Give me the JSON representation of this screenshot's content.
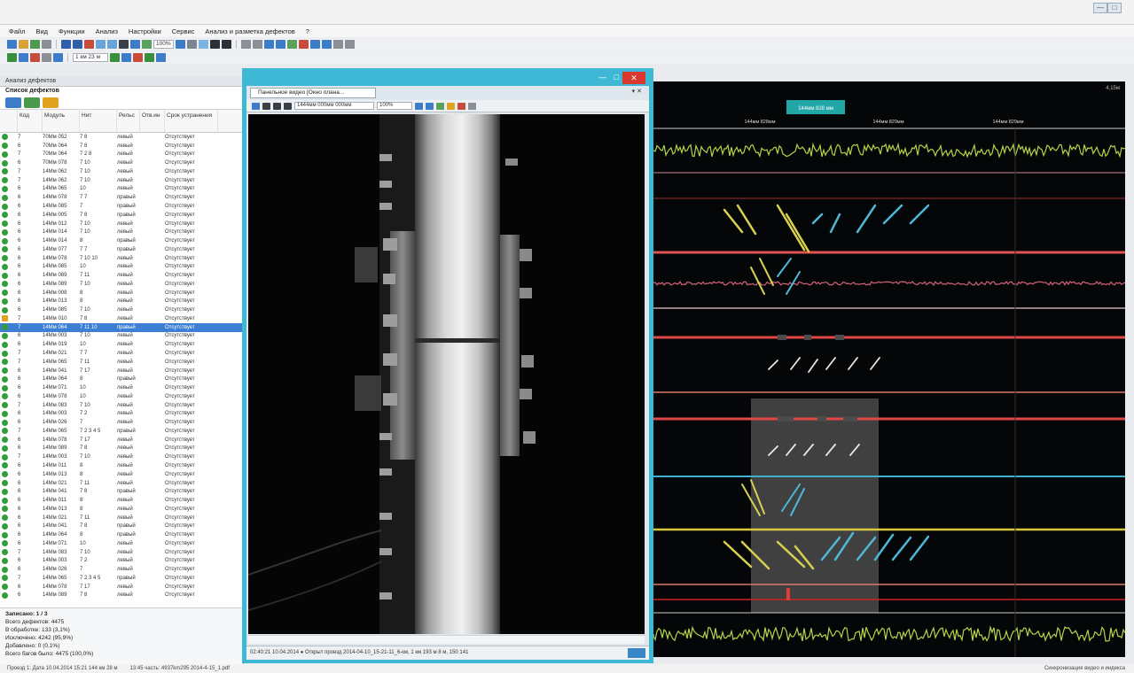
{
  "window": {
    "menu": [
      "Файл",
      "Вид",
      "Функции",
      "Анализ",
      "Настройки",
      "Сервис",
      "Анализ и разметка дефектов",
      "?"
    ],
    "zoom": "100%"
  },
  "left_panel": {
    "tab_label": "Анализ дефектов",
    "section_title": "Список дефектов",
    "columns": [
      "Код",
      "Модуль",
      "Нит",
      "Рельс",
      "Отв.ин",
      "Срок устранения"
    ],
    "rows": [
      {
        "c0": "7",
        "c1": "70Мм 052",
        "c2": "7 8",
        "c3": "левый",
        "c4": "",
        "c5": "Отсутствует"
      },
      {
        "c0": "6",
        "c1": "70Мм 064",
        "c2": "7 8",
        "c3": "левый",
        "c4": "",
        "c5": "Отсутствует"
      },
      {
        "c0": "7",
        "c1": "70Мм 064",
        "c2": "7 2 8",
        "c3": "левый",
        "c4": "",
        "c5": "Отсутствует"
      },
      {
        "c0": "6",
        "c1": "70Мм 078",
        "c2": "7 10",
        "c3": "левый",
        "c4": "",
        "c5": "Отсутствует"
      },
      {
        "c0": "7",
        "c1": "14Мм 062",
        "c2": "7 10",
        "c3": "левый",
        "c4": "",
        "c5": "Отсутствует"
      },
      {
        "c0": "7",
        "c1": "14Мм 062",
        "c2": "7 10",
        "c3": "левый",
        "c4": "",
        "c5": "Отсутствует"
      },
      {
        "c0": "6",
        "c1": "14Мм 065",
        "c2": "10",
        "c3": "левый",
        "c4": "",
        "c5": "Отсутствует"
      },
      {
        "c0": "6",
        "c1": "14Мм 078",
        "c2": "7 7",
        "c3": "правый",
        "c4": "",
        "c5": "Отсутствует"
      },
      {
        "c0": "6",
        "c1": "14Мм 085",
        "c2": "7",
        "c3": "правый",
        "c4": "",
        "c5": "Отсутствует"
      },
      {
        "c0": "6",
        "c1": "14Мм 005",
        "c2": "7 8",
        "c3": "правый",
        "c4": "",
        "c5": "Отсутствует"
      },
      {
        "c0": "6",
        "c1": "14Мм 012",
        "c2": "7 10",
        "c3": "левый",
        "c4": "",
        "c5": "Отсутствует"
      },
      {
        "c0": "6",
        "c1": "14Мм 014",
        "c2": "7 10",
        "c3": "левый",
        "c4": "",
        "c5": "Отсутствует"
      },
      {
        "c0": "6",
        "c1": "14Мм 014",
        "c2": "8",
        "c3": "правый",
        "c4": "",
        "c5": "Отсутствует"
      },
      {
        "c0": "6",
        "c1": "14Мм 077",
        "c2": "7 7",
        "c3": "правый",
        "c4": "",
        "c5": "Отсутствует"
      },
      {
        "c0": "6",
        "c1": "14Мм 078",
        "c2": "7 10 10",
        "c3": "левый",
        "c4": "",
        "c5": "Отсутствует"
      },
      {
        "c0": "6",
        "c1": "14Мм 085",
        "c2": "10",
        "c3": "левый",
        "c4": "",
        "c5": "Отсутствует"
      },
      {
        "c0": "6",
        "c1": "14Мм 089",
        "c2": "7 11",
        "c3": "левый",
        "c4": "",
        "c5": "Отсутствует"
      },
      {
        "c0": "6",
        "c1": "14Мм 089",
        "c2": "7 10",
        "c3": "левый",
        "c4": "",
        "c5": "Отсутствует"
      },
      {
        "c0": "6",
        "c1": "14Мм 008",
        "c2": "8",
        "c3": "левый",
        "c4": "",
        "c5": "Отсутствует"
      },
      {
        "c0": "6",
        "c1": "14Мм 013",
        "c2": "8",
        "c3": "левый",
        "c4": "",
        "c5": "Отсутствует"
      },
      {
        "c0": "6",
        "c1": "14Мм 085",
        "c2": "7 10",
        "c3": "левый",
        "c4": "",
        "c5": "Отсутствует"
      },
      {
        "c0": "7",
        "c1": "14Мм 010",
        "c2": "7 8",
        "c3": "левый",
        "c4": "",
        "c5": "Отсутствует",
        "warn": true
      },
      {
        "c0": "7",
        "c1": "14Мм 064",
        "c2": "7 11 10",
        "c3": "правый",
        "c4": "",
        "c5": "Отсутствует",
        "selected": true
      },
      {
        "c0": "6",
        "c1": "14Мм 003",
        "c2": "7 10",
        "c3": "левый",
        "c4": "",
        "c5": "Отсутствует"
      },
      {
        "c0": "6",
        "c1": "14Мм 019",
        "c2": "10",
        "c3": "левый",
        "c4": "",
        "c5": "Отсутствует"
      },
      {
        "c0": "7",
        "c1": "14Мм 021",
        "c2": "7 7",
        "c3": "левый",
        "c4": "",
        "c5": "Отсутствует"
      },
      {
        "c0": "7",
        "c1": "14Мм 065",
        "c2": "7 11",
        "c3": "левый",
        "c4": "",
        "c5": "Отсутствует"
      },
      {
        "c0": "6",
        "c1": "14Мм 041",
        "c2": "7 17",
        "c3": "левый",
        "c4": "",
        "c5": "Отсутствует"
      },
      {
        "c0": "6",
        "c1": "14Мм 064",
        "c2": "8",
        "c3": "правый",
        "c4": "",
        "c5": "Отсутствует"
      },
      {
        "c0": "6",
        "c1": "14Мм 071",
        "c2": "10",
        "c3": "левый",
        "c4": "",
        "c5": "Отсутствует"
      },
      {
        "c0": "6",
        "c1": "14Мм 078",
        "c2": "10",
        "c3": "левый",
        "c4": "",
        "c5": "Отсутствует"
      },
      {
        "c0": "7",
        "c1": "14Мм 083",
        "c2": "7 10",
        "c3": "левый",
        "c4": "",
        "c5": "Отсутствует"
      },
      {
        "c0": "6",
        "c1": "14Мм 003",
        "c2": "7 2",
        "c3": "левый",
        "c4": "",
        "c5": "Отсутствует"
      },
      {
        "c0": "6",
        "c1": "14Мм 026",
        "c2": "7",
        "c3": "левый",
        "c4": "",
        "c5": "Отсутствует"
      },
      {
        "c0": "7",
        "c1": "14Мм 065",
        "c2": "7 2 3 4 5",
        "c3": "правый",
        "c4": "",
        "c5": "Отсутствует"
      },
      {
        "c0": "6",
        "c1": "14Мм 078",
        "c2": "7 17",
        "c3": "левый",
        "c4": "",
        "c5": "Отсутствует"
      },
      {
        "c0": "6",
        "c1": "14Мм 089",
        "c2": "7 8",
        "c3": "левый",
        "c4": "",
        "c5": "Отсутствует"
      },
      {
        "c0": "7",
        "c1": "14Мм 003",
        "c2": "7 10",
        "c3": "левый",
        "c4": "",
        "c5": "Отсутствует"
      },
      {
        "c0": "6",
        "c1": "14Мм 011",
        "c2": "8",
        "c3": "левый",
        "c4": "",
        "c5": "Отсутствует"
      },
      {
        "c0": "6",
        "c1": "14Мм 013",
        "c2": "8",
        "c3": "левый",
        "c4": "",
        "c5": "Отсутствует"
      },
      {
        "c0": "6",
        "c1": "14Мм 021",
        "c2": "7 11",
        "c3": "левый",
        "c4": "",
        "c5": "Отсутствует"
      },
      {
        "c0": "6",
        "c1": "14Мм 041",
        "c2": "7 8",
        "c3": "правый",
        "c4": "",
        "c5": "Отсутствует"
      },
      {
        "c0": "6",
        "c1": "14Мм 011",
        "c2": "8",
        "c3": "левый",
        "c4": "",
        "c5": "Отсутствует"
      },
      {
        "c0": "6",
        "c1": "14Мм 013",
        "c2": "8",
        "c3": "левый",
        "c4": "",
        "c5": "Отсутствует"
      },
      {
        "c0": "6",
        "c1": "14Мм 021",
        "c2": "7 11",
        "c3": "левый",
        "c4": "",
        "c5": "Отсутствует"
      },
      {
        "c0": "6",
        "c1": "14Мм 041",
        "c2": "7 8",
        "c3": "правый",
        "c4": "",
        "c5": "Отсутствует"
      },
      {
        "c0": "6",
        "c1": "14Мм 064",
        "c2": "8",
        "c3": "правый",
        "c4": "",
        "c5": "Отсутствует"
      },
      {
        "c0": "6",
        "c1": "14Мм 071",
        "c2": "10",
        "c3": "левый",
        "c4": "",
        "c5": "Отсутствует"
      },
      {
        "c0": "7",
        "c1": "14Мм 083",
        "c2": "7 10",
        "c3": "левый",
        "c4": "",
        "c5": "Отсутствует"
      },
      {
        "c0": "6",
        "c1": "14Мм 003",
        "c2": "7 2",
        "c3": "левый",
        "c4": "",
        "c5": "Отсутствует"
      },
      {
        "c0": "6",
        "c1": "14Мм 026",
        "c2": "7",
        "c3": "левый",
        "c4": "",
        "c5": "Отсутствует"
      },
      {
        "c0": "7",
        "c1": "14Мм 065",
        "c2": "7 2 3 4 5",
        "c3": "правый",
        "c4": "",
        "c5": "Отсутствует"
      },
      {
        "c0": "6",
        "c1": "14Мм 078",
        "c2": "7 17",
        "c3": "левый",
        "c4": "",
        "c5": "Отсутствует"
      },
      {
        "c0": "6",
        "c1": "14Мм 089",
        "c2": "7 8",
        "c3": "левый",
        "c4": "",
        "c5": "Отсутствует"
      }
    ],
    "summary": [
      "Записано: 1 / 3",
      "Всего дефектов: 4475",
      "В обработке: 133 (3,1%)",
      "Исключено: 4242 (95,9%)",
      "Добавлено: 0 (0,1%)",
      "Всего багов было: 4475 (100,0%)"
    ]
  },
  "video": {
    "tab_title": "Панельное видео [Окно плана...",
    "tab_ctrl": "▾ ✕",
    "window_min": "—",
    "window_max": "□",
    "window_close": "✕",
    "toolbar_field": "1 км 23 м",
    "toolbar_field2": "1444мм 000мм 000мм",
    "toolbar_zoom": "100%",
    "status": "02:40:21 10.04.2014 ● Открыт проезд 2014-04-10_15-21-11_6-км, 1 км 193 м 8 м, 150 141"
  },
  "signal": {
    "top_right": "4,15м",
    "markers": [
      "144мм 828мм",
      "144мм 829мм",
      "144мм 829мм"
    ],
    "highlight_label": "144мм 828 мм"
  },
  "status_bar": {
    "left": "Проезд 1: Дата 10.04.2014 15:21  144 км 28 м",
    "mid": "13:45 часть: 4937km295 2014-4-15_1.pdf",
    "right": "Синхронизация видео и индекса"
  }
}
